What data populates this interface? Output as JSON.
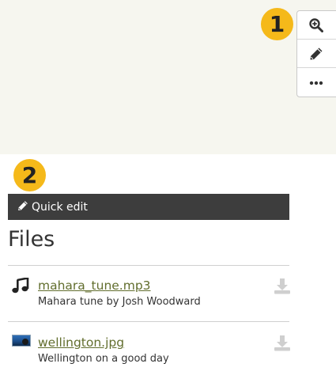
{
  "markers": {
    "first": "1",
    "second": "2"
  },
  "toolbar": {
    "items": [
      {
        "icon": "zoom-in-icon",
        "label": ""
      },
      {
        "icon": "pencil-icon",
        "label": ""
      },
      {
        "icon": "more-icon",
        "label": ""
      }
    ]
  },
  "quick_edit": {
    "label": "Quick edit",
    "icon": "pencil-icon"
  },
  "files": {
    "heading": "Files",
    "items": [
      {
        "name": "mahara_tune.mp3",
        "description": "Mahara tune by Josh Woodward",
        "icon": "music-icon"
      },
      {
        "name": "wellington.jpg",
        "description": "Wellington on a good day",
        "icon": "image-thumbnail"
      }
    ]
  },
  "colors": {
    "marker": "#f5b91a",
    "top_area": "#f6f6ef",
    "quick_edit_bar": "#3d3d3d",
    "link": "#626e2e",
    "download_icon": "#cfcfcf"
  }
}
